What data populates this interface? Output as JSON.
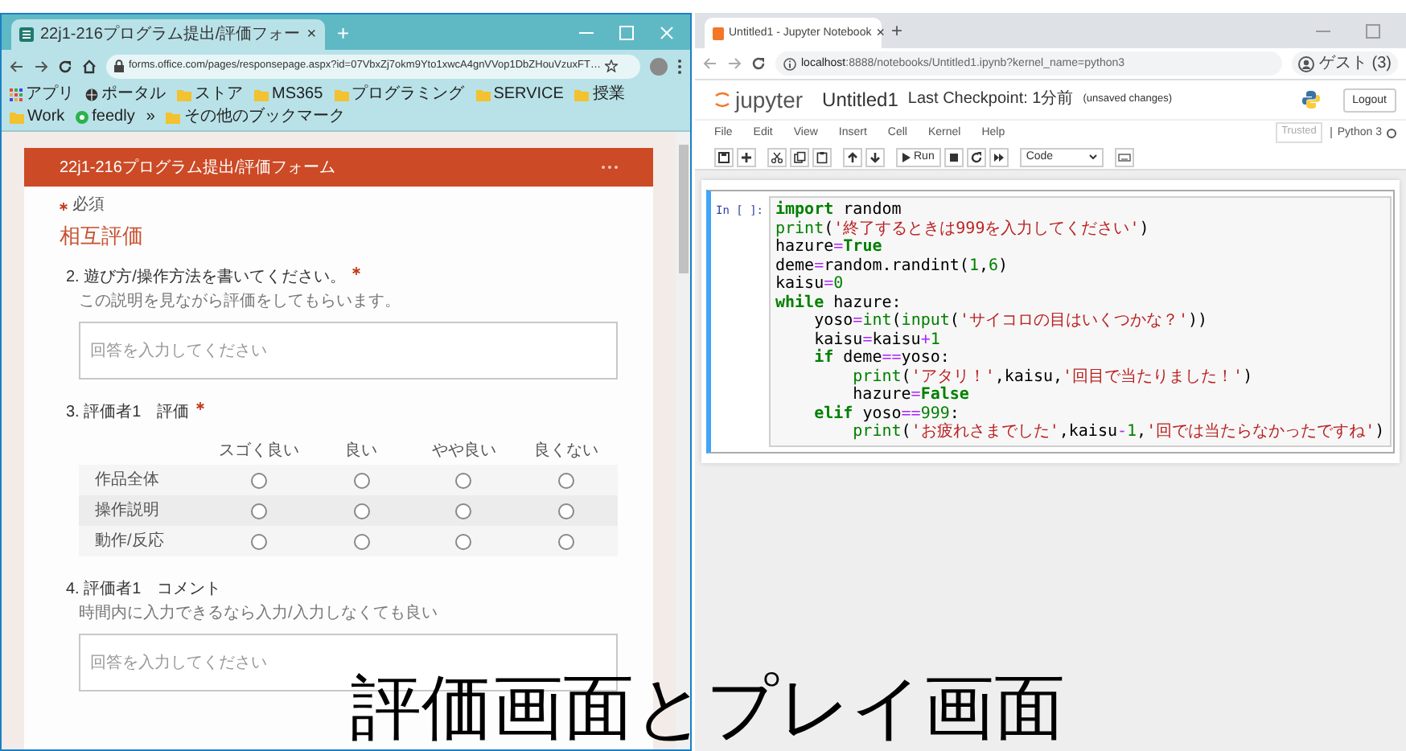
{
  "left_window": {
    "tab": {
      "title": "22j1-216プログラム提出/評価フォー",
      "close": "×",
      "selected": true
    },
    "new_tab": "+",
    "address": "forms.office.com/pages/responsepage.aspx?id=07VbxZj7okm9Yto1xwcA4gnVVop1DbZHouVzuxFT…",
    "bookmarks": [
      {
        "label": "アプリ",
        "kind": "apps"
      },
      {
        "label": "ポータル",
        "kind": "globe"
      },
      {
        "label": "ストア",
        "kind": "folder"
      },
      {
        "label": "MS365",
        "kind": "folder"
      },
      {
        "label": "プログラミング",
        "kind": "folder"
      },
      {
        "label": "SERVICE",
        "kind": "folder"
      },
      {
        "label": "授業",
        "kind": "folder"
      },
      {
        "label": "Work",
        "kind": "folder"
      },
      {
        "label": "feedly",
        "kind": "feed"
      },
      {
        "label": "»",
        "kind": "more"
      },
      {
        "label": "その他のブックマーク",
        "kind": "folder"
      }
    ],
    "form": {
      "title": "22j1-216プログラム提出/評価フォーム",
      "required_note": "必須",
      "section": "相互評価",
      "questions": [
        {
          "kind": "text",
          "title": "2. 遊び方/操作方法を書いてください。",
          "required": true,
          "subtitle": "この説明を見ながら評価をしてもらいます。",
          "placeholder": "回答を入力してください"
        },
        {
          "kind": "matrix",
          "title": "3. 評価者1　評価",
          "required": true,
          "columns": [
            "スゴく良い",
            "良い",
            "やや良い",
            "良くない"
          ],
          "rows": [
            {
              "label": "作品全体",
              "options": [
                {
                  "selected": false
                },
                {
                  "selected": false
                },
                {
                  "selected": false
                },
                {
                  "selected": false
                }
              ]
            },
            {
              "label": "操作説明",
              "options": [
                {
                  "selected": false
                },
                {
                  "selected": false
                },
                {
                  "selected": false
                },
                {
                  "selected": false
                }
              ]
            },
            {
              "label": "動作/反応",
              "options": [
                {
                  "selected": false
                },
                {
                  "selected": false
                },
                {
                  "selected": false
                },
                {
                  "selected": false
                }
              ]
            }
          ]
        },
        {
          "kind": "text",
          "title": "4. 評価者1　コメント",
          "required": false,
          "subtitle": "時間内に入力できるなら入力/入力しなくても良い",
          "placeholder": "回答を入力してください"
        }
      ]
    }
  },
  "right_window": {
    "tab": {
      "title": "Untitled1 - Jupyter Notebook",
      "close": "×",
      "selected": true
    },
    "new_tab": "+",
    "address_host": "localhost",
    "address_rest": ":8888/notebooks/Untitled1.ipynb?kernel_name=python3",
    "profile": "ゲスト (3)",
    "notebook": {
      "logo": "jupyter",
      "name": "Untitled1",
      "checkpoint": "Last Checkpoint: 1分前",
      "unsaved": "(unsaved changes)",
      "logout": "Logout",
      "menu": [
        "File",
        "Edit",
        "View",
        "Insert",
        "Cell",
        "Kernel",
        "Help"
      ],
      "trusted": "Trusted",
      "kernel": "Python 3",
      "toolbar": [
        {
          "kind": "save"
        },
        {
          "kind": "plus"
        },
        {
          "kind": "cut"
        },
        {
          "kind": "copy"
        },
        {
          "kind": "paste"
        },
        {
          "kind": "up"
        },
        {
          "kind": "down"
        },
        {
          "kind": "run",
          "label": "Run"
        },
        {
          "kind": "stop"
        },
        {
          "kind": "restart"
        },
        {
          "kind": "fastforward"
        },
        {
          "kind": "select",
          "label": "Code"
        },
        {
          "kind": "keyboard"
        }
      ],
      "cell": {
        "prompt": "In [ ]:",
        "lines": [
          [
            {
              "text": "import",
              "kind": "kw"
            },
            {
              "text": " random",
              "kind": "plain"
            }
          ],
          [
            {
              "text": "print",
              "kind": "builtin"
            },
            {
              "text": "(",
              "kind": "plain"
            },
            {
              "text": "'終了するときは999を入力してください'",
              "kind": "str"
            },
            {
              "text": ")",
              "kind": "plain"
            }
          ],
          [
            {
              "text": "hazure",
              "kind": "plain"
            },
            {
              "text": "=",
              "kind": "op"
            },
            {
              "text": "True",
              "kind": "kw"
            }
          ],
          [
            {
              "text": "deme",
              "kind": "plain"
            },
            {
              "text": "=",
              "kind": "op"
            },
            {
              "text": "random.randint(",
              "kind": "plain"
            },
            {
              "text": "1",
              "kind": "num"
            },
            {
              "text": ",",
              "kind": "plain"
            },
            {
              "text": "6",
              "kind": "num"
            },
            {
              "text": ")",
              "kind": "plain"
            }
          ],
          [
            {
              "text": "kaisu",
              "kind": "plain"
            },
            {
              "text": "=",
              "kind": "op"
            },
            {
              "text": "0",
              "kind": "num"
            }
          ],
          [
            {
              "text": "while",
              "kind": "kw"
            },
            {
              "text": " hazure:",
              "kind": "plain"
            }
          ],
          [
            {
              "text": "    yoso",
              "kind": "plain"
            },
            {
              "text": "=",
              "kind": "op"
            },
            {
              "text": "int",
              "kind": "builtin"
            },
            {
              "text": "(",
              "kind": "plain"
            },
            {
              "text": "input",
              "kind": "builtin"
            },
            {
              "text": "(",
              "kind": "plain"
            },
            {
              "text": "'サイコロの目はいくつかな？'",
              "kind": "str"
            },
            {
              "text": "))",
              "kind": "plain"
            }
          ],
          [
            {
              "text": "    kaisu",
              "kind": "plain"
            },
            {
              "text": "=",
              "kind": "op"
            },
            {
              "text": "kaisu",
              "kind": "plain"
            },
            {
              "text": "+",
              "kind": "op"
            },
            {
              "text": "1",
              "kind": "num"
            }
          ],
          [
            {
              "text": "    if",
              "kind": "kw"
            },
            {
              "text": " deme",
              "kind": "plain"
            },
            {
              "text": "==",
              "kind": "op"
            },
            {
              "text": "yoso:",
              "kind": "plain"
            }
          ],
          [
            {
              "text": "        print",
              "kind": "builtin"
            },
            {
              "text": "(",
              "kind": "plain"
            },
            {
              "text": "'アタリ！'",
              "kind": "str"
            },
            {
              "text": ",kaisu,",
              "kind": "plain"
            },
            {
              "text": "'回目で当たりました！'",
              "kind": "str"
            },
            {
              "text": ")",
              "kind": "plain"
            }
          ],
          [
            {
              "text": "        hazure",
              "kind": "plain"
            },
            {
              "text": "=",
              "kind": "op"
            },
            {
              "text": "False",
              "kind": "kw"
            }
          ],
          [
            {
              "text": "    elif",
              "kind": "kw"
            },
            {
              "text": " yoso",
              "kind": "plain"
            },
            {
              "text": "==",
              "kind": "op"
            },
            {
              "text": "999",
              "kind": "num"
            },
            {
              "text": ":",
              "kind": "plain"
            }
          ],
          [
            {
              "text": "        print",
              "kind": "builtin"
            },
            {
              "text": "(",
              "kind": "plain"
            },
            {
              "text": "'お疲れさまでした'",
              "kind": "str"
            },
            {
              "text": ",kaisu",
              "kind": "plain"
            },
            {
              "text": "-",
              "kind": "op"
            },
            {
              "text": "1",
              "kind": "num"
            },
            {
              "text": ",",
              "kind": "plain"
            },
            {
              "text": "'回では当たらなかったですね'",
              "kind": "str"
            },
            {
              "text": ")",
              "kind": "plain"
            }
          ]
        ]
      }
    }
  },
  "caption": "評価画面とプレイ画面"
}
